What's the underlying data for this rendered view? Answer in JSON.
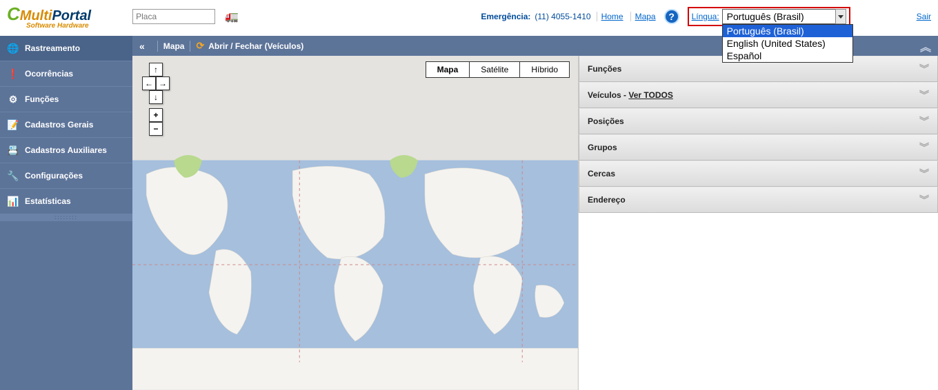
{
  "logo": {
    "multi": "Multi",
    "portal": "Portal",
    "sub": "Software Hardware"
  },
  "search": {
    "placeholder": "Placa"
  },
  "header": {
    "emergencia_label": "Emergência:",
    "emergencia_phone": "(11) 4055-1410",
    "home": "Home",
    "mapa": "Mapa",
    "lingua_label": "Língua:",
    "lang_selected": "Português (Brasil)",
    "lang_options": [
      "Português (Brasil)",
      "English (United States)",
      "Español"
    ],
    "sair": "Sair"
  },
  "sidebar": {
    "items": [
      {
        "label": "Rastreamento",
        "icon": "🌐"
      },
      {
        "label": "Ocorrências",
        "icon": "❗"
      },
      {
        "label": "Funções",
        "icon": "⚙"
      },
      {
        "label": "Cadastros Gerais",
        "icon": "📝"
      },
      {
        "label": "Cadastros Auxiliares",
        "icon": "📇"
      },
      {
        "label": "Configurações",
        "icon": "🔧"
      },
      {
        "label": "Estatísticas",
        "icon": "📊"
      }
    ]
  },
  "toolbar": {
    "mapa": "Mapa",
    "abrir_fechar": "Abrir / Fechar (Veículos)"
  },
  "map_types": {
    "mapa": "Mapa",
    "satelite": "Satélite",
    "hibrido": "Híbrido"
  },
  "panels": {
    "funcoes": "Funções",
    "veiculos_prefix": "Veículos - ",
    "veiculos_link": "Ver TODOS",
    "posicoes": "Posições",
    "grupos": "Grupos",
    "cercas": "Cercas",
    "endereco": "Endereço"
  }
}
